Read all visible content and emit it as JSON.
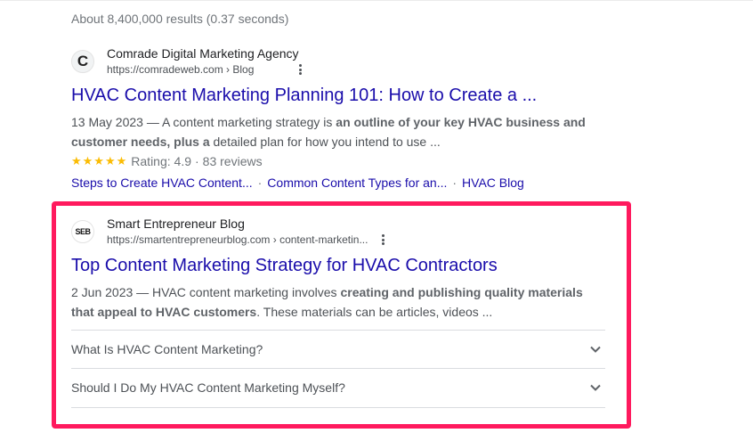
{
  "stats": "About 8,400,000 results (0.37 seconds)",
  "results": [
    {
      "favicon_letter": "C",
      "site_name": "Comrade Digital Marketing Agency",
      "url": "https://comradeweb.com › Blog",
      "title": "HVAC Content Marketing Planning 101: How to Create a ...",
      "snippet_date": "13 May 2023 —",
      "snippet_parts": [
        " A content marketing strategy is ",
        "an outline of your key HVAC business and customer needs, plus a",
        " detailed plan for how you intend to use ..."
      ],
      "stars": "★★★★★",
      "rating_label": "Rating: 4.9",
      "rating_sep": "·",
      "reviews": "83 reviews",
      "sitelinks": [
        "Steps to Create HVAC Content...",
        "Common Content Types for an...",
        "HVAC Blog"
      ],
      "sitelink_sep": "·"
    },
    {
      "favicon_letter": "SEB",
      "site_name": "Smart Entrepreneur Blog",
      "url": "https://smartentrepreneurblog.com › content-marketin...",
      "title": "Top Content Marketing Strategy for HVAC Contractors",
      "snippet_date": "2 Jun 2023 —",
      "snippet_parts": [
        " HVAC content marketing involves ",
        "creating and publishing quality materials that appeal to HVAC customers",
        ". These materials can be articles, videos ..."
      ],
      "faq": [
        "What Is HVAC Content Marketing?",
        "Should I Do My HVAC Content Marketing Myself?"
      ]
    }
  ],
  "colors": {
    "link": "#1a0dab",
    "highlight": "#ff1a5e",
    "stars": "#fbbc04",
    "text": "#4d5156"
  },
  "icons": {
    "more": "kebab-menu-icon",
    "expand": "chevron-down-icon"
  }
}
